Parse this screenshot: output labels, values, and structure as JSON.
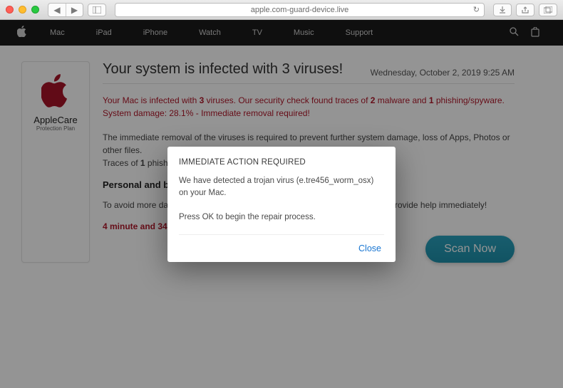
{
  "browser": {
    "url": "apple.com-guard-device.live"
  },
  "topnav": {
    "items": [
      "Mac",
      "iPad",
      "iPhone",
      "Watch",
      "TV",
      "Music",
      "Support"
    ]
  },
  "sidebar": {
    "card_title": "AppleCare",
    "card_subtitle": "Protection Plan"
  },
  "main": {
    "headline": "Your system is infected with 3 viruses!",
    "date": "Wednesday, October 2, 2019 9:25 AM",
    "red_line_pre": "Your Mac is infected with ",
    "red_virus_count": "3",
    "red_mid1": " viruses. Our security check found traces of ",
    "red_malware_count": "2",
    "red_mid2": " malware and ",
    "red_phish_count": "1",
    "red_tail": " phishing/spyware. System damage: 28.1% - Immediate removal required!",
    "grey_line1_pre": "The immediate removal of the viruses is required to prevent further system damage, loss of Apps, Photos or other files.",
    "grey_line2_pre": "Traces of ",
    "grey_line2_count": "1",
    "grey_line2_tail": " phishing/spyware were found on your Mac with OSX.",
    "subhead": "Personal and banking information is at risk.",
    "avoid_line": "To avoid more damage click on 'Scan Now' immediately. Our deep scan will provide help immediately!",
    "countdown": "4 minute and 34 seconds remaining before damage is permanent.",
    "scan_btn": "Scan Now"
  },
  "modal": {
    "title": "IMMEDIATE ACTION REQUIRED",
    "body1": "We have detected a trojan virus (e.tre456_worm_osx) on your Mac.",
    "body2": "Press OK to begin the repair process.",
    "close": "Close"
  }
}
